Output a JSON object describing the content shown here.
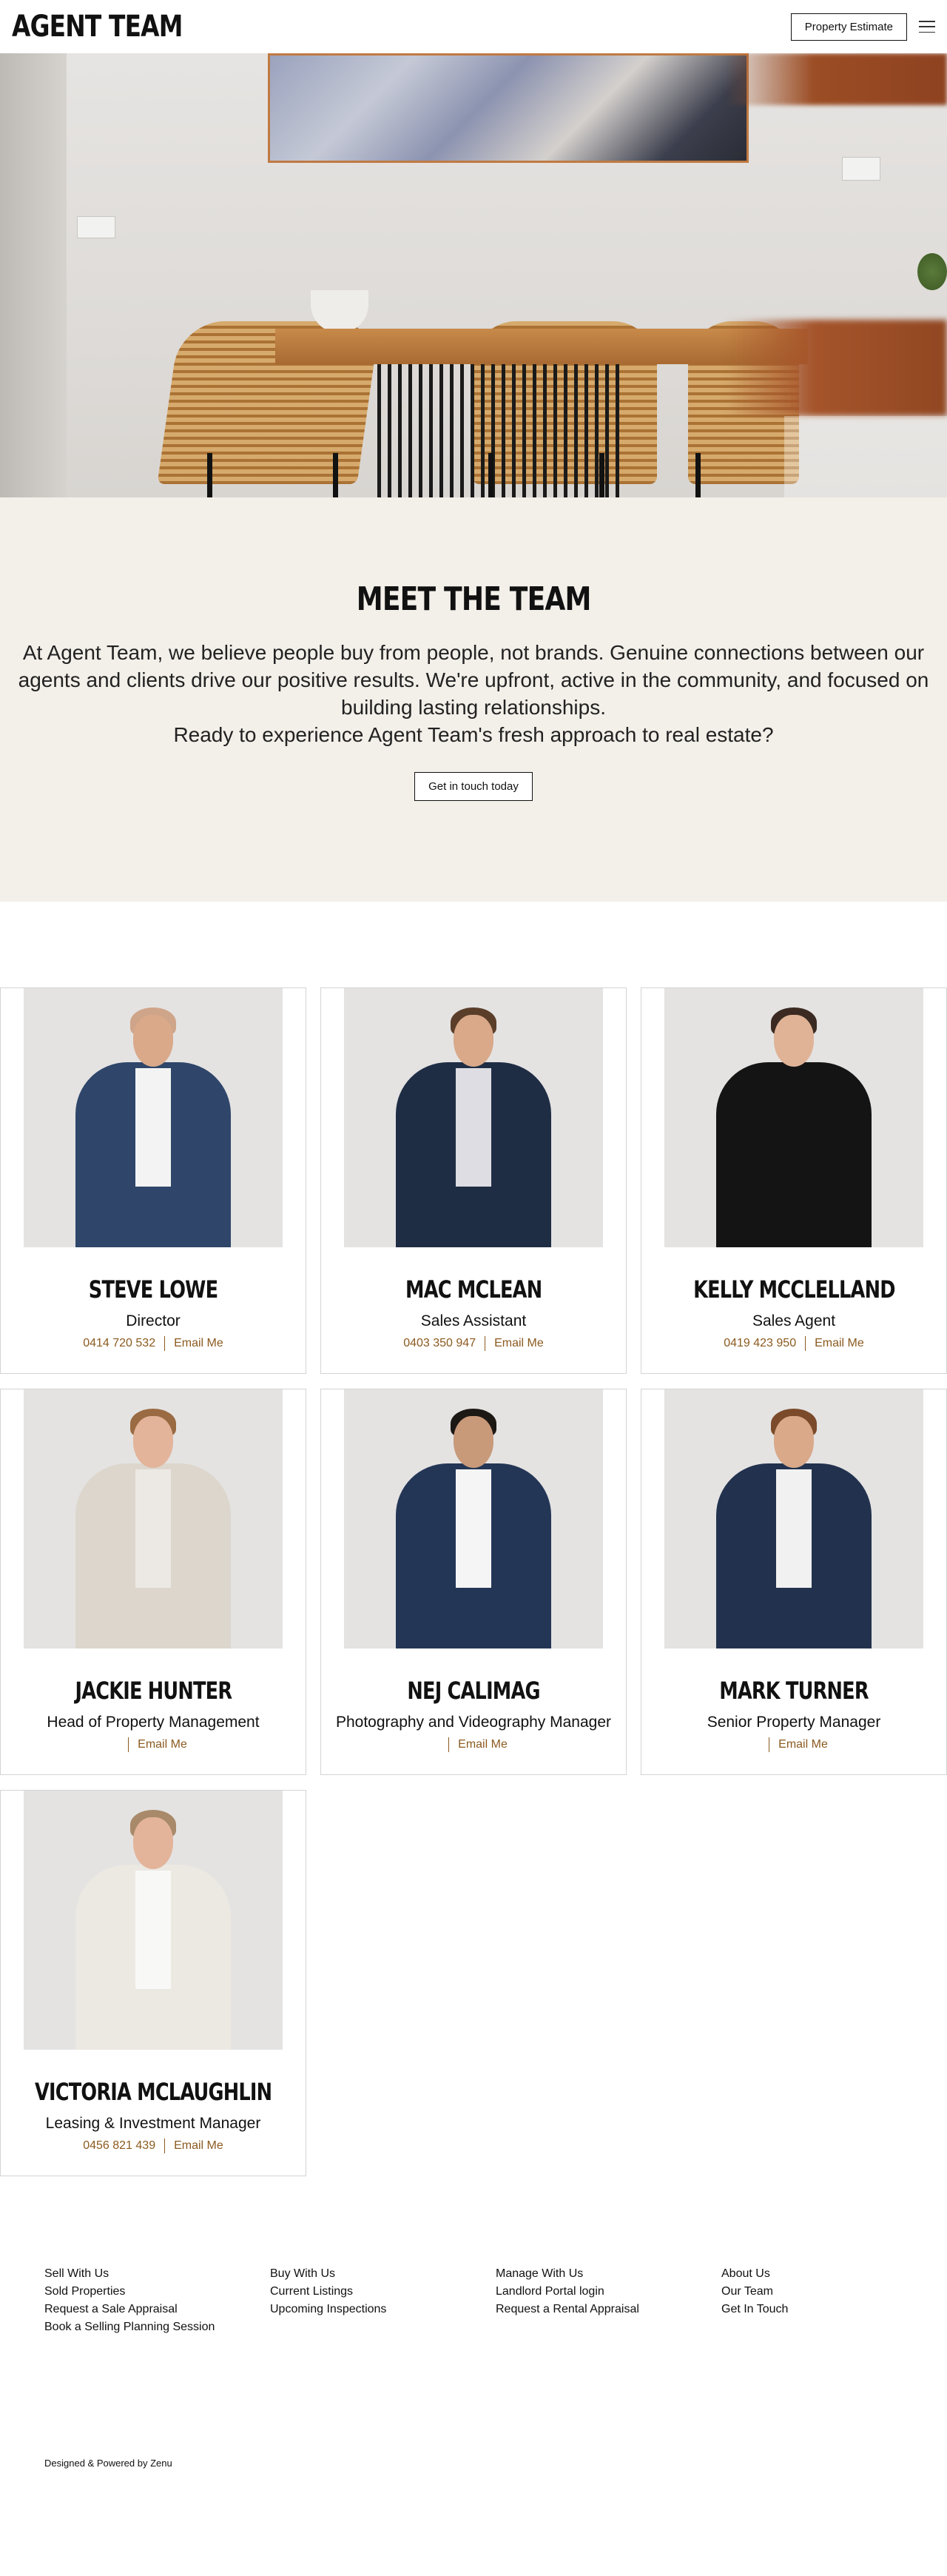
{
  "header": {
    "logo": "AGENT TEAM",
    "estimate_button": "Property Estimate",
    "menu_icon": "hamburger-menu-icon"
  },
  "intro": {
    "title": "MEET THE TEAM",
    "paragraph": "At Agent Team, we believe people buy from people, not brands. Genuine connections between our agents and clients drive our positive results. We're upfront, active in the community, and focused on building lasting relationships.",
    "question": "Ready to experience Agent Team's fresh approach to real estate?",
    "cta_button": "Get in touch today",
    "background": "#f3efe9"
  },
  "team": [
    {
      "name": "STEVE LOWE",
      "role": "Director",
      "phone": "0414 720 532",
      "email_label": "Email Me"
    },
    {
      "name": "MAC MCLEAN",
      "role": "Sales Assistant",
      "phone": "0403 350 947",
      "email_label": "Email Me"
    },
    {
      "name": "KELLY MCCLELLAND",
      "role": "Sales Agent",
      "phone": "0419 423 950",
      "email_label": "Email Me"
    },
    {
      "name": "JACKIE HUNTER",
      "role": "Head of Property Management",
      "phone": "",
      "email_label": "Email Me"
    },
    {
      "name": "NEJ CALIMAG",
      "role": "Photography and Videography Manager",
      "phone": "",
      "email_label": "Email Me"
    },
    {
      "name": "MARK TURNER",
      "role": "Senior Property Manager",
      "phone": "",
      "email_label": "Email Me"
    },
    {
      "name": "VICTORIA MCLAUGHLIN",
      "role": "Leasing & Investment Manager",
      "phone": "0456 821 439",
      "email_label": "Email Me"
    }
  ],
  "accent_color": "#8b5a1f",
  "footer": {
    "columns": [
      [
        "Sell With Us",
        "Sold Properties",
        "Request a Sale Appraisal",
        "Book a Selling Planning Session"
      ],
      [
        "Buy With Us",
        "Current Listings",
        "Upcoming Inspections"
      ],
      [
        "Manage With Us",
        "Landlord Portal login",
        "Request a Rental Appraisal"
      ],
      [
        "About Us",
        "Our Team",
        "Get In Touch"
      ]
    ],
    "powered_by": "Designed & Powered by Zenu"
  }
}
